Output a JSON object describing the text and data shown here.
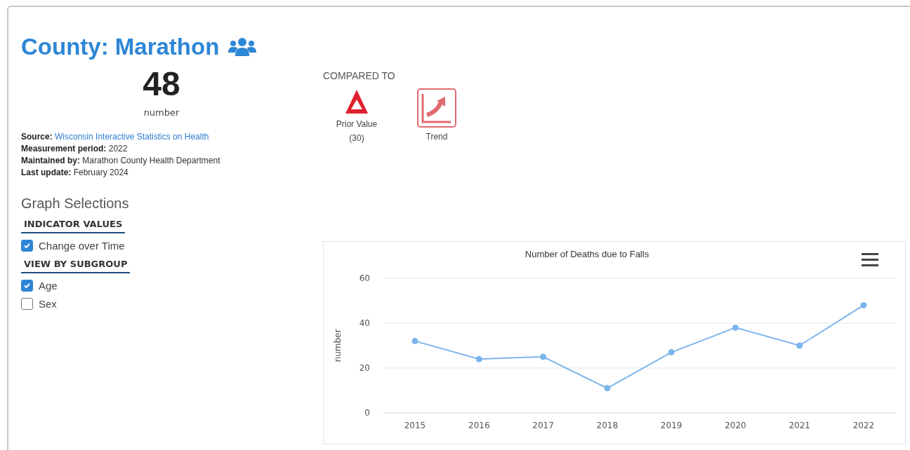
{
  "title": "County: Marathon",
  "value": {
    "number": "48",
    "unit": "number"
  },
  "details": [
    {
      "label": "Source:",
      "value": "Wisconsin Interactive Statistics on Health",
      "kind": "link"
    },
    {
      "label": "Measurement period:",
      "value": "2022",
      "kind": "text"
    },
    {
      "label": "Maintained by:",
      "value": "Marathon County Health Department",
      "kind": "text"
    },
    {
      "label": "Last update:",
      "value": "February 2024",
      "kind": "text"
    }
  ],
  "graph_selections": {
    "title": "Graph Selections",
    "groups": [
      {
        "heading": "INDICATOR VALUES",
        "options": [
          {
            "label": "Change over Time",
            "checked": true
          }
        ]
      },
      {
        "heading": "VIEW BY SUBGROUP",
        "options": [
          {
            "label": "Age",
            "checked": true
          },
          {
            "label": "Sex",
            "checked": false
          }
        ]
      }
    ]
  },
  "compared_to": {
    "heading": "COMPARED TO",
    "items": [
      {
        "kind": "prior",
        "label": "Prior Value",
        "detail": "(30)"
      },
      {
        "kind": "trend",
        "label": "Trend"
      }
    ]
  },
  "chart": {
    "chart_data": {
      "type": "line",
      "title": "Number of Deaths due to Falls",
      "ylabel": "number",
      "categories": [
        "2015",
        "2016",
        "2017",
        "2018",
        "2019",
        "2020",
        "2021",
        "2022"
      ],
      "series": [
        {
          "color": "#7cb5ec",
          "marker": "circle",
          "values": [
            32,
            24,
            25,
            11,
            27,
            38,
            30,
            48
          ]
        }
      ],
      "ylim": [
        0,
        60
      ],
      "yticks": [
        0,
        20,
        40,
        60
      ]
    }
  }
}
